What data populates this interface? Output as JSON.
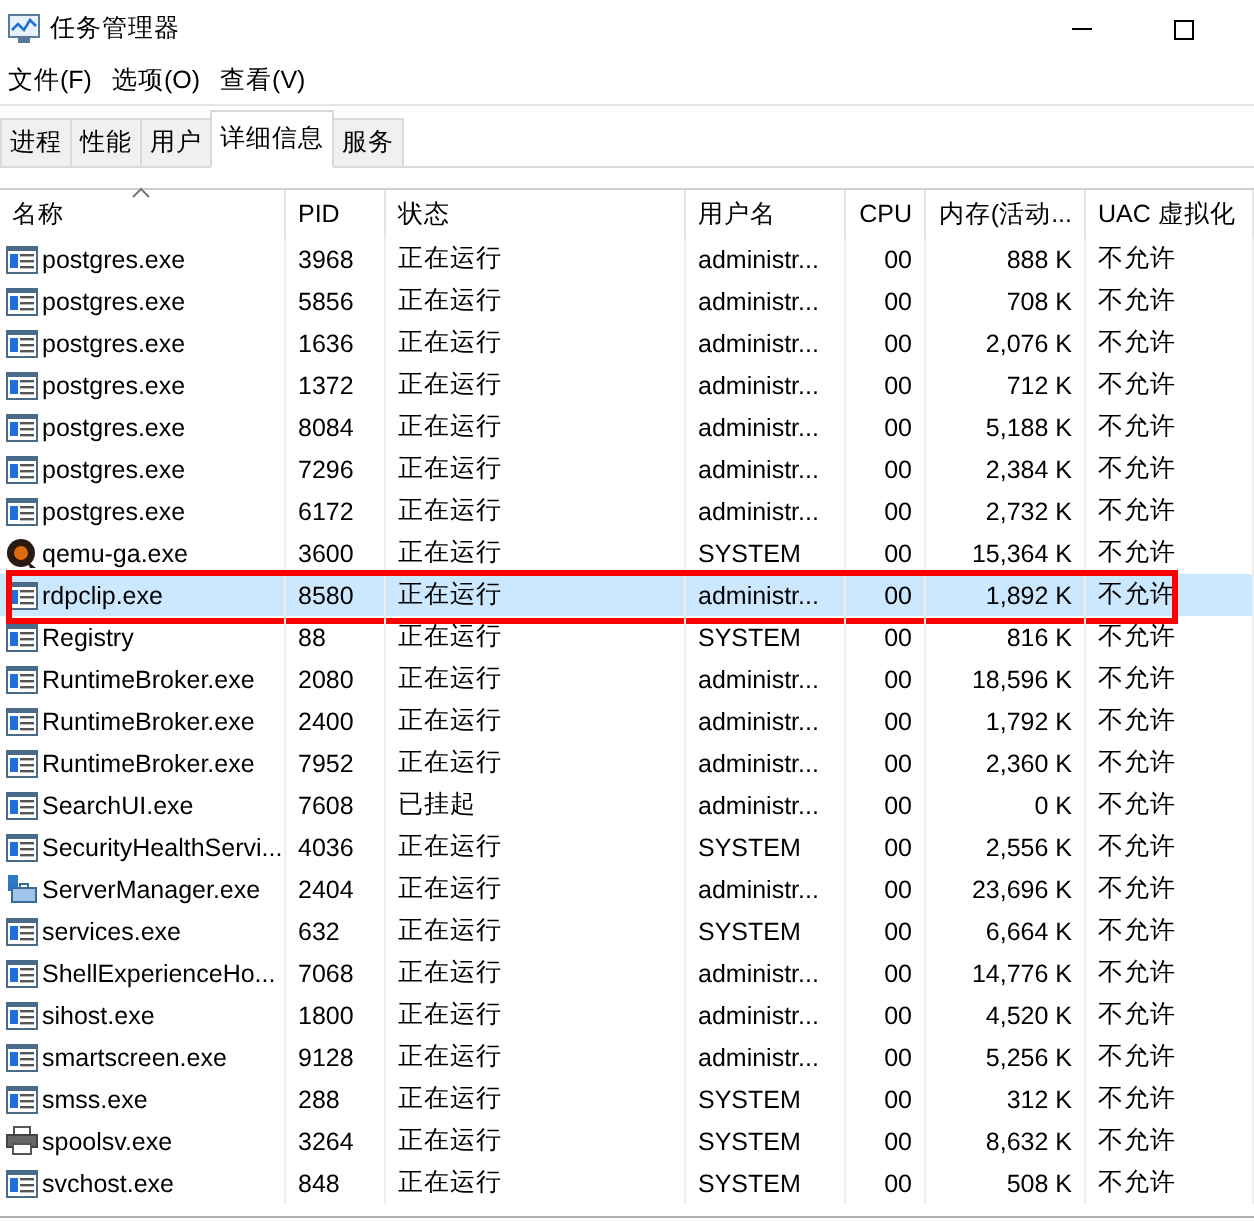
{
  "window": {
    "title": "任务管理器"
  },
  "menu": [
    "文件(F)",
    "选项(O)",
    "查看(V)"
  ],
  "tabs": [
    {
      "label": "进程",
      "selected": false
    },
    {
      "label": "性能",
      "selected": false
    },
    {
      "label": "用户",
      "selected": false
    },
    {
      "label": "详细信息",
      "selected": true
    },
    {
      "label": "服务",
      "selected": false
    }
  ],
  "table": {
    "columns": [
      {
        "label": "名称",
        "sorted": true
      },
      {
        "label": "PID",
        "sorted": false
      },
      {
        "label": "状态",
        "sorted": false
      },
      {
        "label": "用户名",
        "sorted": false
      },
      {
        "label": "CPU",
        "sorted": false
      },
      {
        "label": "内存(活动...",
        "sorted": false
      },
      {
        "label": "UAC 虚拟化",
        "sorted": false
      }
    ],
    "rows": [
      {
        "kind": "window",
        "cells": [
          "postgres.exe",
          "3968",
          "正在运行",
          "administr...",
          "00",
          "888 K",
          "不允许"
        ],
        "selected": false,
        "marked": false
      },
      {
        "kind": "window",
        "cells": [
          "postgres.exe",
          "5856",
          "正在运行",
          "administr...",
          "00",
          "708 K",
          "不允许"
        ],
        "selected": false,
        "marked": false
      },
      {
        "kind": "window",
        "cells": [
          "postgres.exe",
          "1636",
          "正在运行",
          "administr...",
          "00",
          "2,076 K",
          "不允许"
        ],
        "selected": false,
        "marked": false
      },
      {
        "kind": "window",
        "cells": [
          "postgres.exe",
          "1372",
          "正在运行",
          "administr...",
          "00",
          "712 K",
          "不允许"
        ],
        "selected": false,
        "marked": false
      },
      {
        "kind": "window",
        "cells": [
          "postgres.exe",
          "8084",
          "正在运行",
          "administr...",
          "00",
          "5,188 K",
          "不允许"
        ],
        "selected": false,
        "marked": false
      },
      {
        "kind": "window",
        "cells": [
          "postgres.exe",
          "7296",
          "正在运行",
          "administr...",
          "00",
          "2,384 K",
          "不允许"
        ],
        "selected": false,
        "marked": false
      },
      {
        "kind": "window",
        "cells": [
          "postgres.exe",
          "6172",
          "正在运行",
          "administr...",
          "00",
          "2,732 K",
          "不允许"
        ],
        "selected": false,
        "marked": false
      },
      {
        "kind": "qemu",
        "cells": [
          "qemu-ga.exe",
          "3600",
          "正在运行",
          "SYSTEM",
          "00",
          "15,364 K",
          "不允许"
        ],
        "selected": false,
        "marked": false
      },
      {
        "kind": "window",
        "cells": [
          "rdpclip.exe",
          "8580",
          "正在运行",
          "administr...",
          "00",
          "1,892 K",
          "不允许"
        ],
        "selected": true,
        "marked": true
      },
      {
        "kind": "window",
        "cells": [
          "Registry",
          "88",
          "正在运行",
          "SYSTEM",
          "00",
          "816 K",
          "不允许"
        ],
        "selected": false,
        "marked": false
      },
      {
        "kind": "window",
        "cells": [
          "RuntimeBroker.exe",
          "2080",
          "正在运行",
          "administr...",
          "00",
          "18,596 K",
          "不允许"
        ],
        "selected": false,
        "marked": false
      },
      {
        "kind": "window",
        "cells": [
          "RuntimeBroker.exe",
          "2400",
          "正在运行",
          "administr...",
          "00",
          "1,792 K",
          "不允许"
        ],
        "selected": false,
        "marked": false
      },
      {
        "kind": "window",
        "cells": [
          "RuntimeBroker.exe",
          "7952",
          "正在运行",
          "administr...",
          "00",
          "2,360 K",
          "不允许"
        ],
        "selected": false,
        "marked": false
      },
      {
        "kind": "window",
        "cells": [
          "SearchUI.exe",
          "7608",
          "已挂起",
          "administr...",
          "00",
          "0 K",
          "不允许"
        ],
        "selected": false,
        "marked": false
      },
      {
        "kind": "window",
        "cells": [
          "SecurityHealthServi...",
          "4036",
          "正在运行",
          "SYSTEM",
          "00",
          "2,556 K",
          "不允许"
        ],
        "selected": false,
        "marked": false
      },
      {
        "kind": "server",
        "cells": [
          "ServerManager.exe",
          "2404",
          "正在运行",
          "administr...",
          "00",
          "23,696 K",
          "不允许"
        ],
        "selected": false,
        "marked": false
      },
      {
        "kind": "window",
        "cells": [
          "services.exe",
          "632",
          "正在运行",
          "SYSTEM",
          "00",
          "6,664 K",
          "不允许"
        ],
        "selected": false,
        "marked": false
      },
      {
        "kind": "window",
        "cells": [
          "ShellExperienceHo...",
          "7068",
          "正在运行",
          "administr...",
          "00",
          "14,776 K",
          "不允许"
        ],
        "selected": false,
        "marked": false
      },
      {
        "kind": "window",
        "cells": [
          "sihost.exe",
          "1800",
          "正在运行",
          "administr...",
          "00",
          "4,520 K",
          "不允许"
        ],
        "selected": false,
        "marked": false
      },
      {
        "kind": "window",
        "cells": [
          "smartscreen.exe",
          "9128",
          "正在运行",
          "administr...",
          "00",
          "5,256 K",
          "不允许"
        ],
        "selected": false,
        "marked": false
      },
      {
        "kind": "window",
        "cells": [
          "smss.exe",
          "288",
          "正在运行",
          "SYSTEM",
          "00",
          "312 K",
          "不允许"
        ],
        "selected": false,
        "marked": false
      },
      {
        "kind": "printer",
        "cells": [
          "spoolsv.exe",
          "3264",
          "正在运行",
          "SYSTEM",
          "00",
          "8,632 K",
          "不允许"
        ],
        "selected": false,
        "marked": false
      },
      {
        "kind": "window",
        "cells": [
          "svchost.exe",
          "848",
          "正在运行",
          "SYSTEM",
          "00",
          "508 K",
          "不允许"
        ],
        "selected": false,
        "marked": false
      }
    ]
  }
}
